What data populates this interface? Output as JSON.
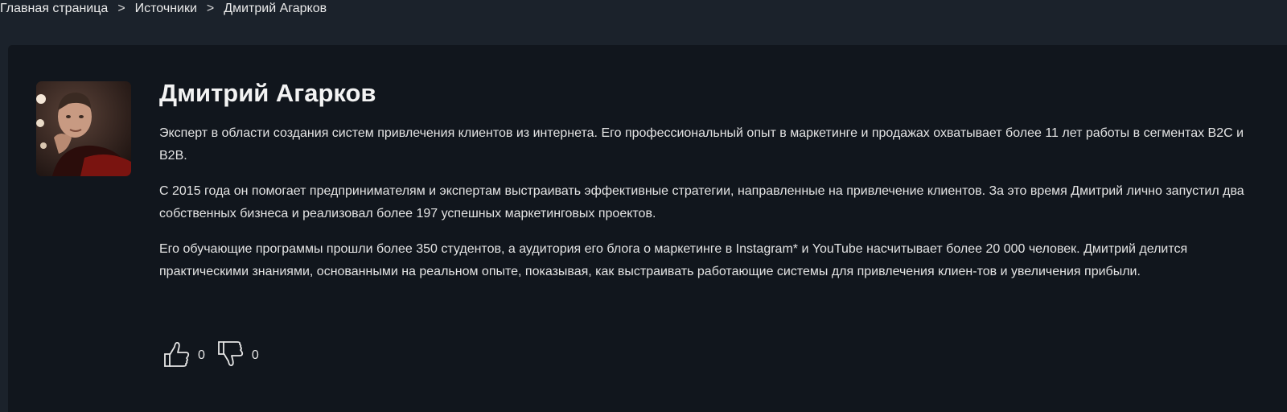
{
  "breadcrumb": {
    "items": [
      "Главная страница",
      "Источники",
      "Дмитрий Агарков"
    ],
    "separator": ">"
  },
  "author": {
    "name": "Дмитрий Агарков",
    "bio": [
      "Эксперт в области создания систем привлечения клиентов из интернета. Его профессиональный опыт в маркетинге и продажах охватывает более 11 лет работы в сегментах B2C и B2B.",
      "С 2015 года он помогает предпринимателям и экспертам выстраивать эффективные стратегии, направленные на привлечение клиентов. За это время Дмитрий лично запустил два собственных бизнеса и реализовал более 197 успешных маркетинговых проектов.",
      "Его обучающие программы прошли более 350 студентов, а аудитория его блога о маркетинге в Instagram* и YouTube насчитывает более 20 000 человек. Дмитрий делится практическими знаниями, основанными на реальном опыте, показывая, как выстраивать работающие системы для привлечения клиен-тов и увеличения прибыли."
    ]
  },
  "reactions": {
    "likes": "0",
    "dislikes": "0",
    "like_icon": "thumbs-up-icon",
    "dislike_icon": "thumbs-down-icon"
  },
  "colors": {
    "page_bg": "#1b222b",
    "card_bg": "#11161d",
    "text": "#e4e4e4"
  }
}
